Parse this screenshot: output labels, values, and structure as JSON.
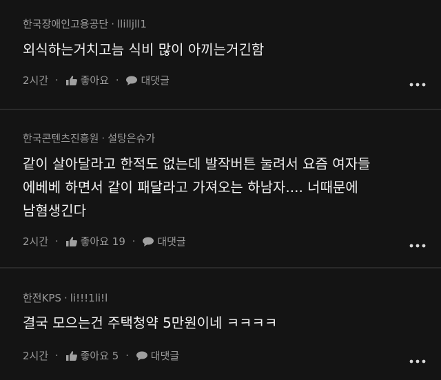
{
  "colors": {
    "background": "#111111",
    "card": "#141414",
    "text_primary": "#efefef",
    "text_secondary": "#9a9a9a"
  },
  "comments": [
    {
      "company": "한국장애인고용공단",
      "separator": "·",
      "nickname": "llilljll1",
      "text_lines": [
        "외식하는거치고늠 식비 많이 아끼는거긴함"
      ],
      "time": "2시간",
      "meta_dot": "·",
      "like_icon": "thumbs-up-icon",
      "like_label": "좋아요",
      "reply_icon": "speech-bubble-icon",
      "reply_label": "대댓글",
      "more_icon": "more-dots-icon"
    },
    {
      "company": "한국콘텐츠진흥원",
      "separator": "·",
      "nickname": "설탕은슈가",
      "text_lines": [
        "같이 살아달라고 한적도 없는데 발작버튼 눌려서 요즘 여자들",
        "에베베 하면서 같이 패달라고 가져오는 하남자.... 너때문에",
        "남혐생긴다"
      ],
      "time": "2시간",
      "meta_dot": "·",
      "like_icon": "thumbs-up-icon",
      "like_label": "좋아요 19",
      "reply_icon": "speech-bubble-icon",
      "reply_label": "대댓글",
      "more_icon": "more-dots-icon"
    },
    {
      "company": "한전KPS",
      "separator": "·",
      "nickname": "li!!!1li!l",
      "text_lines": [
        "결국 모으는건 주택청약 5만원이네 ㅋㅋㅋㅋ"
      ],
      "time": "2시간",
      "meta_dot": "·",
      "like_icon": "thumbs-up-icon",
      "like_label": "좋아요 5",
      "reply_icon": "speech-bubble-icon",
      "reply_label": "대댓글",
      "more_icon": "more-dots-icon"
    }
  ]
}
